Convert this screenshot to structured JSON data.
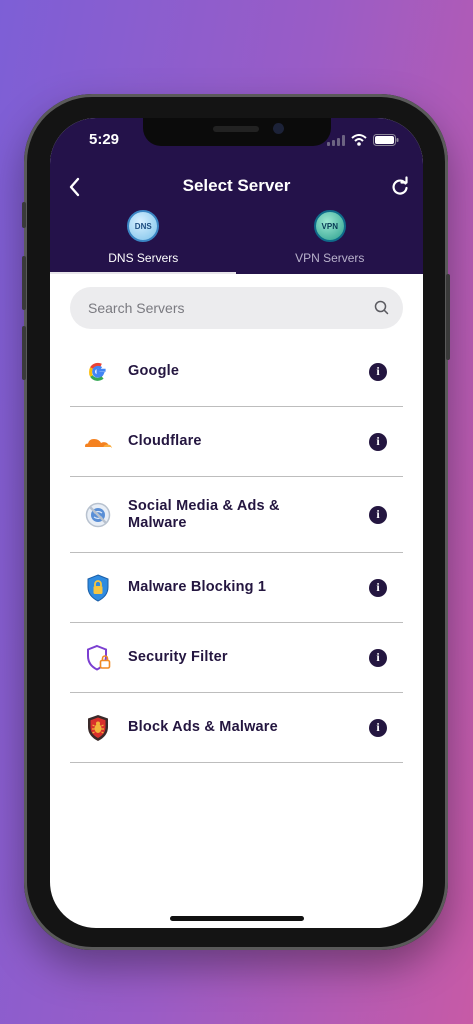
{
  "status_bar": {
    "time": "5:29"
  },
  "header": {
    "title": "Select Server"
  },
  "tabs": [
    {
      "label": "DNS Servers",
      "icon": "dns-globe-icon",
      "icon_text": "DNS",
      "active": true
    },
    {
      "label": "VPN Servers",
      "icon": "vpn-globe-icon",
      "icon_text": "VPN",
      "active": false
    }
  ],
  "search": {
    "placeholder": "Search Servers",
    "value": ""
  },
  "servers": [
    {
      "label": "Google",
      "icon": "google-logo-icon"
    },
    {
      "label": "Cloudflare",
      "icon": "cloudflare-logo-icon"
    },
    {
      "label": "Social Media & Ads & Malware",
      "icon": "block-social-icon"
    },
    {
      "label": "Malware Blocking 1",
      "icon": "shield-lock-icon"
    },
    {
      "label": "Security Filter",
      "icon": "security-filter-icon"
    },
    {
      "label": "Block Ads & Malware",
      "icon": "bug-shield-icon"
    }
  ],
  "colors": {
    "header_bg": "#24124a",
    "text_primary": "#241640",
    "search_bg": "#ececee"
  }
}
